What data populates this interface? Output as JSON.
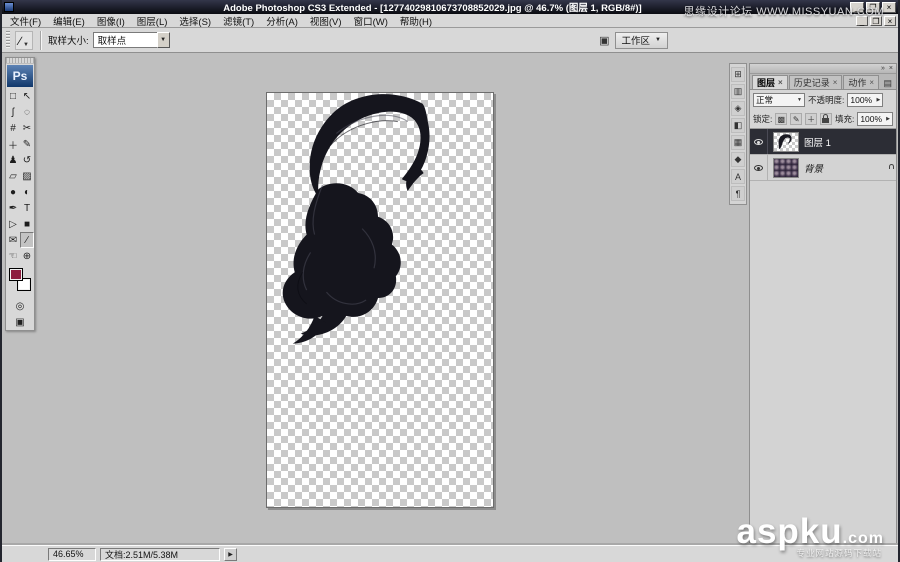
{
  "ui": {
    "close": "×",
    "min": "_",
    "restore": "❐",
    "arrow_down": "▼",
    "arrow_right": "▶",
    "panel_menu": "▤",
    "collapse_right": "»"
  },
  "window": {
    "title": "Adobe Photoshop CS3 Extended - [12774029810673708852029.jpg @ 46.7% (图层 1, RGB/8#)]"
  },
  "menu": {
    "items": [
      "文件(F)",
      "编辑(E)",
      "图像(I)",
      "图层(L)",
      "选择(S)",
      "滤镜(T)",
      "分析(A)",
      "视图(V)",
      "窗口(W)",
      "帮助(H)"
    ]
  },
  "options_bar": {
    "sample_size_label": "取样大小:",
    "sample_size_value": "取样点",
    "workspace_icon": "▣",
    "workspace_label": "工作区"
  },
  "toolbox": {
    "logo": "Ps",
    "tools": [
      {
        "name": "rectangular-marquee",
        "glyph": "□"
      },
      {
        "name": "move",
        "glyph": "↖"
      },
      {
        "name": "lasso",
        "glyph": "ʃ"
      },
      {
        "name": "quick-selection",
        "glyph": "◌"
      },
      {
        "name": "crop",
        "glyph": "#"
      },
      {
        "name": "slice",
        "glyph": "✂"
      },
      {
        "name": "spot-healing-brush",
        "glyph": "＋"
      },
      {
        "name": "brush",
        "glyph": "✎"
      },
      {
        "name": "clone-stamp",
        "glyph": "♟"
      },
      {
        "name": "history-brush",
        "glyph": "↺"
      },
      {
        "name": "eraser",
        "glyph": "▱"
      },
      {
        "name": "gradient",
        "glyph": "▨"
      },
      {
        "name": "blur",
        "glyph": "●"
      },
      {
        "name": "dodge",
        "glyph": "◐"
      },
      {
        "name": "pen",
        "glyph": "✒"
      },
      {
        "name": "type",
        "glyph": "T"
      },
      {
        "name": "path-selection",
        "glyph": "▷"
      },
      {
        "name": "custom-shape",
        "glyph": "■"
      },
      {
        "name": "notes",
        "glyph": "✉"
      },
      {
        "name": "eyedropper",
        "glyph": "∕"
      },
      {
        "name": "hand",
        "glyph": "☜"
      },
      {
        "name": "zoom",
        "glyph": "⊕"
      }
    ],
    "quick_mask_glyph": "◎",
    "screen_mode_glyph": "▣",
    "foreground_color": "#8d1c3e",
    "background_color": "#ffffff"
  },
  "dock_strip": {
    "icons": [
      {
        "name": "navigator-icon",
        "glyph": "⊞"
      },
      {
        "name": "histogram-icon",
        "glyph": "▥"
      },
      {
        "name": "info-icon",
        "glyph": "◈"
      },
      {
        "name": "color-icon",
        "glyph": "◧"
      },
      {
        "name": "swatches-icon",
        "glyph": "▦"
      },
      {
        "name": "styles-icon",
        "glyph": "◆"
      },
      {
        "name": "character-icon",
        "glyph": "A"
      },
      {
        "name": "paragraph-icon",
        "glyph": "¶"
      }
    ]
  },
  "layers_panel": {
    "tabs": [
      {
        "label": "图层",
        "active": true
      },
      {
        "label": "历史记录",
        "active": false
      },
      {
        "label": "动作",
        "active": false
      }
    ],
    "blend_mode": "正常",
    "opacity_label": "不透明度:",
    "opacity_value": "100%",
    "lock_label": "锁定:",
    "lock_icons": [
      {
        "name": "lock-transparency-icon",
        "glyph": "▩"
      },
      {
        "name": "lock-pixels-icon",
        "glyph": "✎"
      },
      {
        "name": "lock-position-icon",
        "glyph": "＋"
      }
    ],
    "fill_label": "填充:",
    "fill_value": "100%",
    "layers": [
      {
        "name": "图层 1"
      },
      {
        "name": "背景"
      }
    ]
  },
  "status_bar": {
    "zoom": "46.65%",
    "doc_label": "文档:2.51M/5.38M"
  },
  "watermarks": {
    "forum": "思缘设计论坛 WWW.MISSYUAN.COM",
    "brand": "aspku",
    "brand_suffix": ".com",
    "tagline": "专业网站源码下载站"
  }
}
